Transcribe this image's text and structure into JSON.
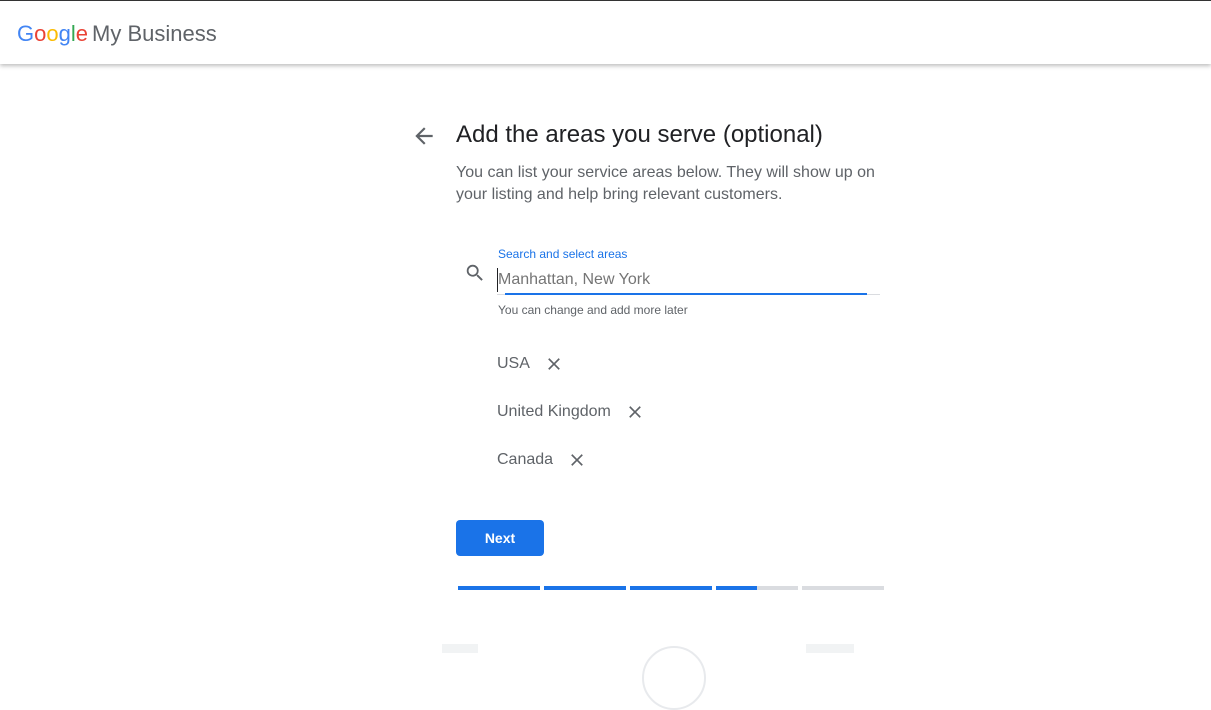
{
  "header": {
    "brand_google": [
      "G",
      "o",
      "o",
      "g",
      "l",
      "e"
    ],
    "brand_product": "My Business"
  },
  "page": {
    "title": "Add the areas you serve (optional)",
    "subtitle": "You can list your service areas below. They will show up on your listing and help bring relevant customers."
  },
  "search": {
    "label": "Search and select areas",
    "placeholder": "Manhattan, New York",
    "value": "",
    "helper": "You can change and add more later"
  },
  "areas": [
    {
      "label": "USA"
    },
    {
      "label": "United Kingdom"
    },
    {
      "label": "Canada"
    }
  ],
  "actions": {
    "next_label": "Next"
  },
  "progress": {
    "steps": [
      1,
      1,
      1,
      0.5,
      0
    ],
    "color": "#1a73e8"
  },
  "icons": {
    "back": "arrow-back-icon",
    "search": "search-icon",
    "remove": "close-icon"
  }
}
